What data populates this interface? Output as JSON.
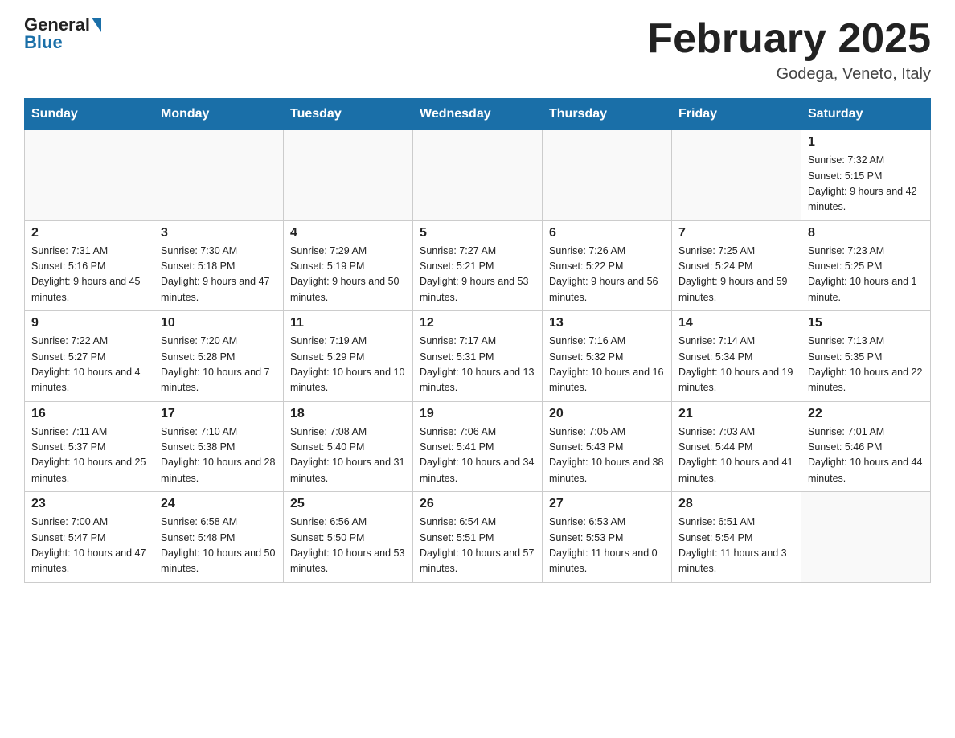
{
  "header": {
    "logo_general": "General",
    "logo_blue": "Blue",
    "title": "February 2025",
    "location": "Godega, Veneto, Italy"
  },
  "weekdays": [
    "Sunday",
    "Monday",
    "Tuesday",
    "Wednesday",
    "Thursday",
    "Friday",
    "Saturday"
  ],
  "weeks": [
    [
      {
        "day": "",
        "info": ""
      },
      {
        "day": "",
        "info": ""
      },
      {
        "day": "",
        "info": ""
      },
      {
        "day": "",
        "info": ""
      },
      {
        "day": "",
        "info": ""
      },
      {
        "day": "",
        "info": ""
      },
      {
        "day": "1",
        "info": "Sunrise: 7:32 AM\nSunset: 5:15 PM\nDaylight: 9 hours and 42 minutes."
      }
    ],
    [
      {
        "day": "2",
        "info": "Sunrise: 7:31 AM\nSunset: 5:16 PM\nDaylight: 9 hours and 45 minutes."
      },
      {
        "day": "3",
        "info": "Sunrise: 7:30 AM\nSunset: 5:18 PM\nDaylight: 9 hours and 47 minutes."
      },
      {
        "day": "4",
        "info": "Sunrise: 7:29 AM\nSunset: 5:19 PM\nDaylight: 9 hours and 50 minutes."
      },
      {
        "day": "5",
        "info": "Sunrise: 7:27 AM\nSunset: 5:21 PM\nDaylight: 9 hours and 53 minutes."
      },
      {
        "day": "6",
        "info": "Sunrise: 7:26 AM\nSunset: 5:22 PM\nDaylight: 9 hours and 56 minutes."
      },
      {
        "day": "7",
        "info": "Sunrise: 7:25 AM\nSunset: 5:24 PM\nDaylight: 9 hours and 59 minutes."
      },
      {
        "day": "8",
        "info": "Sunrise: 7:23 AM\nSunset: 5:25 PM\nDaylight: 10 hours and 1 minute."
      }
    ],
    [
      {
        "day": "9",
        "info": "Sunrise: 7:22 AM\nSunset: 5:27 PM\nDaylight: 10 hours and 4 minutes."
      },
      {
        "day": "10",
        "info": "Sunrise: 7:20 AM\nSunset: 5:28 PM\nDaylight: 10 hours and 7 minutes."
      },
      {
        "day": "11",
        "info": "Sunrise: 7:19 AM\nSunset: 5:29 PM\nDaylight: 10 hours and 10 minutes."
      },
      {
        "day": "12",
        "info": "Sunrise: 7:17 AM\nSunset: 5:31 PM\nDaylight: 10 hours and 13 minutes."
      },
      {
        "day": "13",
        "info": "Sunrise: 7:16 AM\nSunset: 5:32 PM\nDaylight: 10 hours and 16 minutes."
      },
      {
        "day": "14",
        "info": "Sunrise: 7:14 AM\nSunset: 5:34 PM\nDaylight: 10 hours and 19 minutes."
      },
      {
        "day": "15",
        "info": "Sunrise: 7:13 AM\nSunset: 5:35 PM\nDaylight: 10 hours and 22 minutes."
      }
    ],
    [
      {
        "day": "16",
        "info": "Sunrise: 7:11 AM\nSunset: 5:37 PM\nDaylight: 10 hours and 25 minutes."
      },
      {
        "day": "17",
        "info": "Sunrise: 7:10 AM\nSunset: 5:38 PM\nDaylight: 10 hours and 28 minutes."
      },
      {
        "day": "18",
        "info": "Sunrise: 7:08 AM\nSunset: 5:40 PM\nDaylight: 10 hours and 31 minutes."
      },
      {
        "day": "19",
        "info": "Sunrise: 7:06 AM\nSunset: 5:41 PM\nDaylight: 10 hours and 34 minutes."
      },
      {
        "day": "20",
        "info": "Sunrise: 7:05 AM\nSunset: 5:43 PM\nDaylight: 10 hours and 38 minutes."
      },
      {
        "day": "21",
        "info": "Sunrise: 7:03 AM\nSunset: 5:44 PM\nDaylight: 10 hours and 41 minutes."
      },
      {
        "day": "22",
        "info": "Sunrise: 7:01 AM\nSunset: 5:46 PM\nDaylight: 10 hours and 44 minutes."
      }
    ],
    [
      {
        "day": "23",
        "info": "Sunrise: 7:00 AM\nSunset: 5:47 PM\nDaylight: 10 hours and 47 minutes."
      },
      {
        "day": "24",
        "info": "Sunrise: 6:58 AM\nSunset: 5:48 PM\nDaylight: 10 hours and 50 minutes."
      },
      {
        "day": "25",
        "info": "Sunrise: 6:56 AM\nSunset: 5:50 PM\nDaylight: 10 hours and 53 minutes."
      },
      {
        "day": "26",
        "info": "Sunrise: 6:54 AM\nSunset: 5:51 PM\nDaylight: 10 hours and 57 minutes."
      },
      {
        "day": "27",
        "info": "Sunrise: 6:53 AM\nSunset: 5:53 PM\nDaylight: 11 hours and 0 minutes."
      },
      {
        "day": "28",
        "info": "Sunrise: 6:51 AM\nSunset: 5:54 PM\nDaylight: 11 hours and 3 minutes."
      },
      {
        "day": "",
        "info": ""
      }
    ]
  ]
}
